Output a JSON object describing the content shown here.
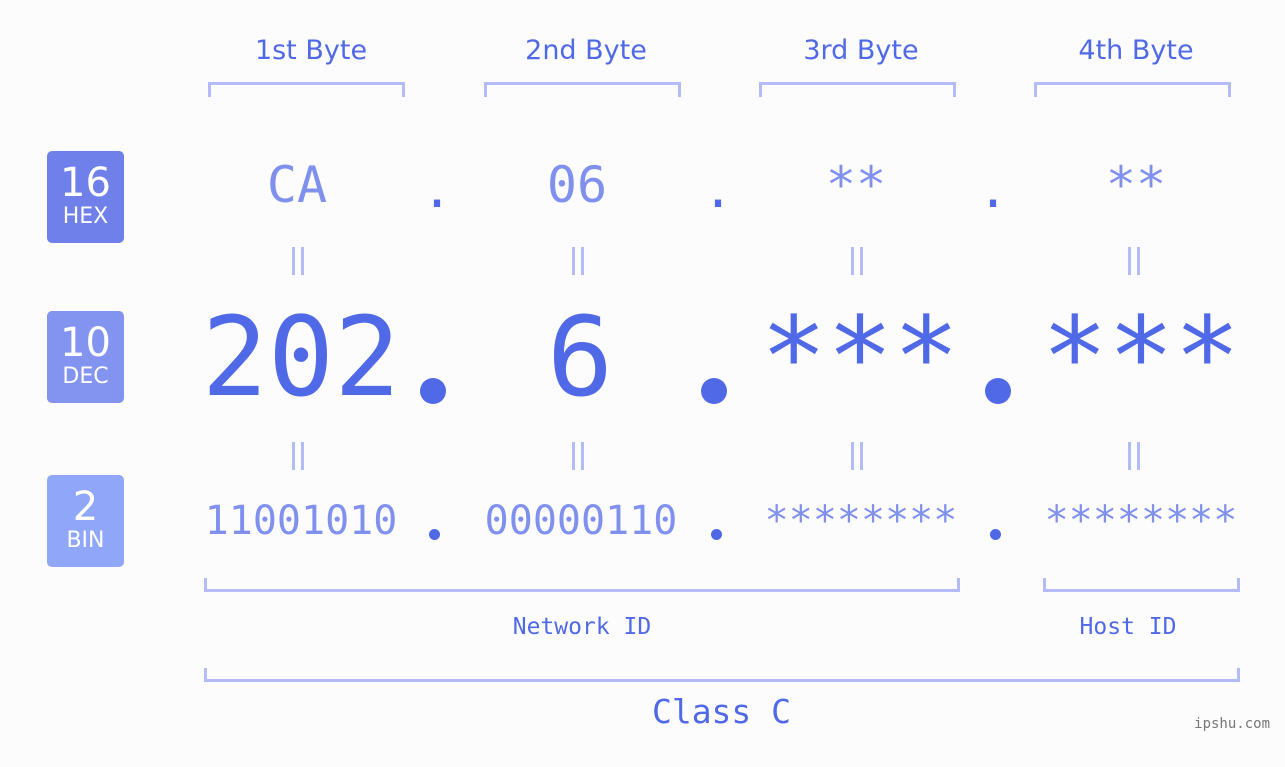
{
  "bases": [
    {
      "number": "16",
      "label": "HEX",
      "color": "#6f80ea"
    },
    {
      "number": "10",
      "label": "DEC",
      "color": "#8393f0"
    },
    {
      "number": "2",
      "label": "BIN",
      "color": "#8fa6f9"
    }
  ],
  "byte_headers": [
    "1st Byte",
    "2nd Byte",
    "3rd Byte",
    "4th Byte"
  ],
  "hex": [
    "CA",
    "06",
    "**",
    "**"
  ],
  "dec": [
    "202",
    "6",
    "***",
    "***"
  ],
  "bin": [
    "11001010",
    "00000110",
    "********",
    "********"
  ],
  "dot": ".",
  "segments": {
    "network_id": "Network ID",
    "host_id": "Host ID"
  },
  "ip_class": "Class C",
  "watermark": "ipshu.com",
  "colors": {
    "primary": "#5069e6",
    "secondary": "#8090ee",
    "bracket": "#b3bcf8",
    "background": "#fbfcfb"
  }
}
